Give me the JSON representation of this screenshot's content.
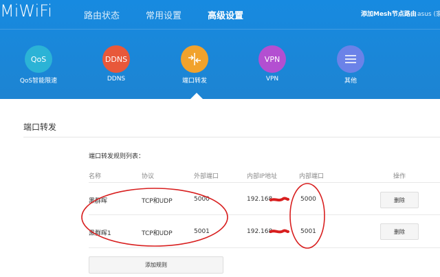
{
  "header": {
    "logo": "MiWiFi",
    "nav": [
      {
        "label": "路由状态",
        "active": false
      },
      {
        "label": "常用设置",
        "active": false
      },
      {
        "label": "高级设置",
        "active": true
      }
    ],
    "mesh_link": "添加Mesh节点路由",
    "user": "asus (家"
  },
  "tools": [
    {
      "icon": "QoS",
      "label": "QoS智能限速",
      "color": "#2bb3d6",
      "active": false
    },
    {
      "icon": "DDNS",
      "label": "DDNS",
      "color": "#e8583a",
      "active": false
    },
    {
      "icon": "port-forward-icon",
      "label": "端口转发",
      "color": "#f1a22c",
      "active": true
    },
    {
      "icon": "VPN",
      "label": "VPN",
      "color": "#b34fd1",
      "active": false
    },
    {
      "icon": "menu-icon",
      "label": "其他",
      "color": "#6b82e8",
      "active": false
    }
  ],
  "section": {
    "title": "端口转发",
    "list_title": "端口转发规则列表：",
    "columns": [
      "名称",
      "协议",
      "外部端口",
      "内部IP地址",
      "内部端口",
      "操作"
    ],
    "rows": [
      {
        "name": "黑群晖",
        "protocol": "TCP和UDP",
        "external_port": "5000",
        "internal_ip": "192.168",
        "internal_port": "5000",
        "action": "删除"
      },
      {
        "name": "黑群晖1",
        "protocol": "TCP和UDP",
        "external_port": "5001",
        "internal_ip": "192.168",
        "internal_port": "5001",
        "action": "删除"
      }
    ],
    "add_button": "添加规则"
  },
  "annotation_color": "#d81e1e"
}
